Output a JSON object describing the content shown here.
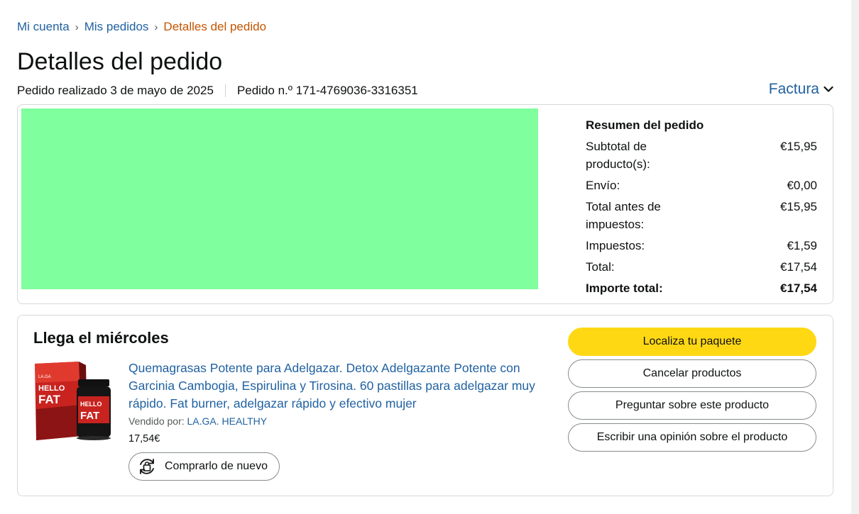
{
  "breadcrumb": {
    "account": "Mi cuenta",
    "orders": "Mis pedidos",
    "current": "Detalles del pedido",
    "separator": "›"
  },
  "page": {
    "title": "Detalles del pedido",
    "order_date": "Pedido realizado 3 de mayo de 2025",
    "order_number": "Pedido n.º 171-4769036-3316351",
    "invoice_label": "Factura"
  },
  "summary": {
    "title": "Resumen del pedido",
    "rows": [
      {
        "label": "Subtotal de producto(s):",
        "value": "€15,95"
      },
      {
        "label": "Envío:",
        "value": "€0,00"
      },
      {
        "label": "Total antes de impuestos:",
        "value": "€15,95"
      },
      {
        "label": "Impuestos:",
        "value": "€1,59"
      },
      {
        "label": "Total:",
        "value": "€17,54"
      }
    ],
    "grand_total": {
      "label": "Importe total:",
      "value": "€17,54"
    }
  },
  "shipment": {
    "arrival": "Llega el miércoles",
    "product": {
      "title": "Quemagrasas Potente para Adelgazar. Detox Adelgazante Potente con Garcinia Cambogia, Espirulina y Tirosina. 60 pastillas para adelgazar muy rápido. Fat burner, adelgazar rápido y efectivo mujer",
      "sold_by_label": "Vendido por:",
      "seller": "LA.GA. HEALTHY",
      "price": "17,54€",
      "buy_again": "Comprarlo de nuevo",
      "image_text": {
        "brand": "LA.GA",
        "line1": "HELLO",
        "line2": "FAT"
      }
    },
    "actions": {
      "track": "Localiza tu paquete",
      "cancel": "Cancelar productos",
      "ask": "Preguntar sobre este producto",
      "review": "Escribir una opinión sobre el producto"
    }
  },
  "colors": {
    "link": "#2162a1",
    "current_crumb": "#c45500",
    "primary_button": "#ffd814",
    "redacted_block": "#80ff9f",
    "product_red": "#c8231f"
  },
  "icons": [
    "chevron-down-icon",
    "buy-again-icon"
  ]
}
